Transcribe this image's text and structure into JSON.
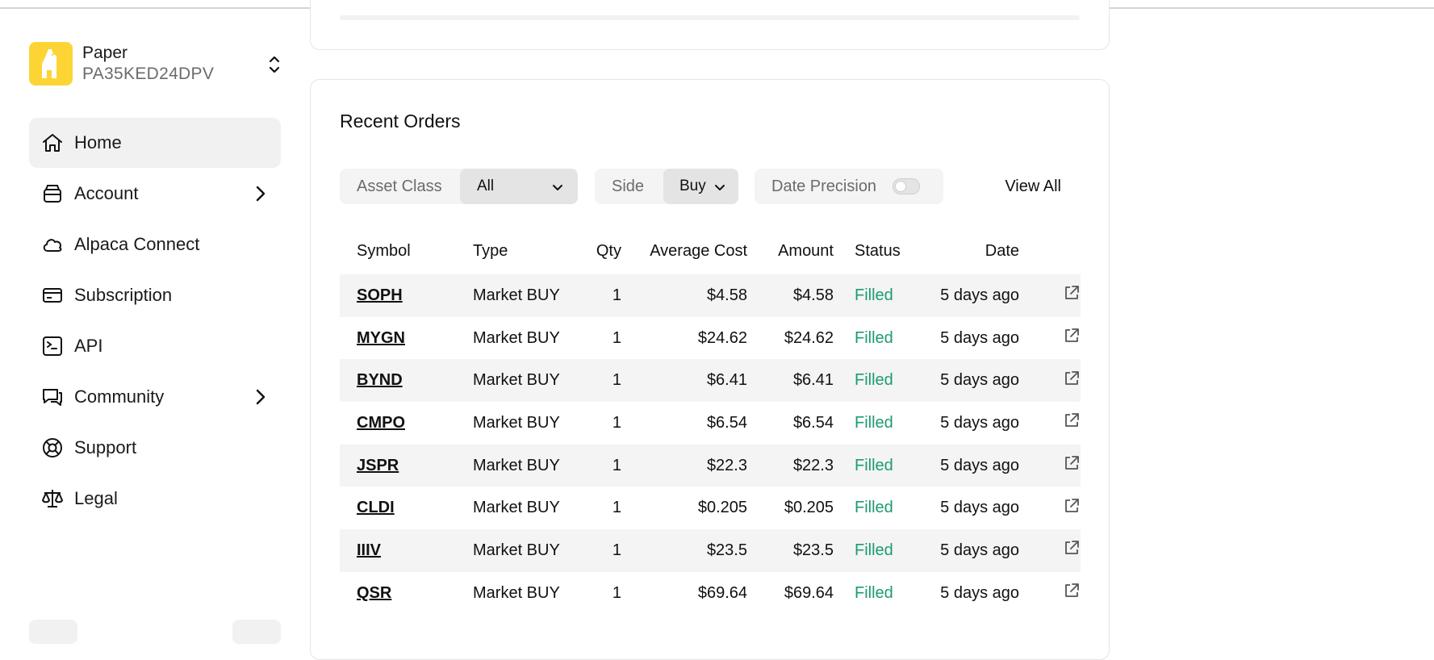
{
  "account": {
    "type": "Paper",
    "id": "PA35KED24DPV"
  },
  "nav": [
    {
      "label": "Home",
      "icon": "home-icon",
      "active": true
    },
    {
      "label": "Account",
      "icon": "wallet-icon",
      "has_submenu": true
    },
    {
      "label": "Alpaca Connect",
      "icon": "cloud-icon"
    },
    {
      "label": "Subscription",
      "icon": "credit-card-icon"
    },
    {
      "label": "API",
      "icon": "terminal-icon"
    },
    {
      "label": "Community",
      "icon": "chat-icon",
      "has_submenu": true
    },
    {
      "label": "Support",
      "icon": "lifebuoy-icon"
    },
    {
      "label": "Legal",
      "icon": "scale-icon"
    }
  ],
  "orders": {
    "title": "Recent Orders",
    "filters": {
      "asset_class_label": "Asset Class",
      "asset_class_value": "All",
      "side_label": "Side",
      "side_value": "Buy",
      "date_precision_label": "Date Precision",
      "date_precision_on": false,
      "view_all": "View All"
    },
    "columns": {
      "symbol": "Symbol",
      "type": "Type",
      "qty": "Qty",
      "avg_cost": "Average Cost",
      "amount": "Amount",
      "status": "Status",
      "date": "Date"
    },
    "rows": [
      {
        "symbol": "SOPH",
        "type": "Market BUY",
        "qty": "1",
        "avg_cost": "$4.58",
        "amount": "$4.58",
        "status": "Filled",
        "date": "5 days ago"
      },
      {
        "symbol": "MYGN",
        "type": "Market BUY",
        "qty": "1",
        "avg_cost": "$24.62",
        "amount": "$24.62",
        "status": "Filled",
        "date": "5 days ago"
      },
      {
        "symbol": "BYND",
        "type": "Market BUY",
        "qty": "1",
        "avg_cost": "$6.41",
        "amount": "$6.41",
        "status": "Filled",
        "date": "5 days ago"
      },
      {
        "symbol": "CMPO",
        "type": "Market BUY",
        "qty": "1",
        "avg_cost": "$6.54",
        "amount": "$6.54",
        "status": "Filled",
        "date": "5 days ago"
      },
      {
        "symbol": "JSPR",
        "type": "Market BUY",
        "qty": "1",
        "avg_cost": "$22.3",
        "amount": "$22.3",
        "status": "Filled",
        "date": "5 days ago"
      },
      {
        "symbol": "CLDI",
        "type": "Market BUY",
        "qty": "1",
        "avg_cost": "$0.205",
        "amount": "$0.205",
        "status": "Filled",
        "date": "5 days ago"
      },
      {
        "symbol": "IIIV",
        "type": "Market BUY",
        "qty": "1",
        "avg_cost": "$23.5",
        "amount": "$23.5",
        "status": "Filled",
        "date": "5 days ago"
      },
      {
        "symbol": "QSR",
        "type": "Market BUY",
        "qty": "1",
        "avg_cost": "$69.64",
        "amount": "$69.64",
        "status": "Filled",
        "date": "5 days ago"
      }
    ]
  },
  "colors": {
    "brand_yellow": "#fcd535",
    "filled_green": "#1c9b73",
    "zebra_row": "#f4f4f4"
  }
}
